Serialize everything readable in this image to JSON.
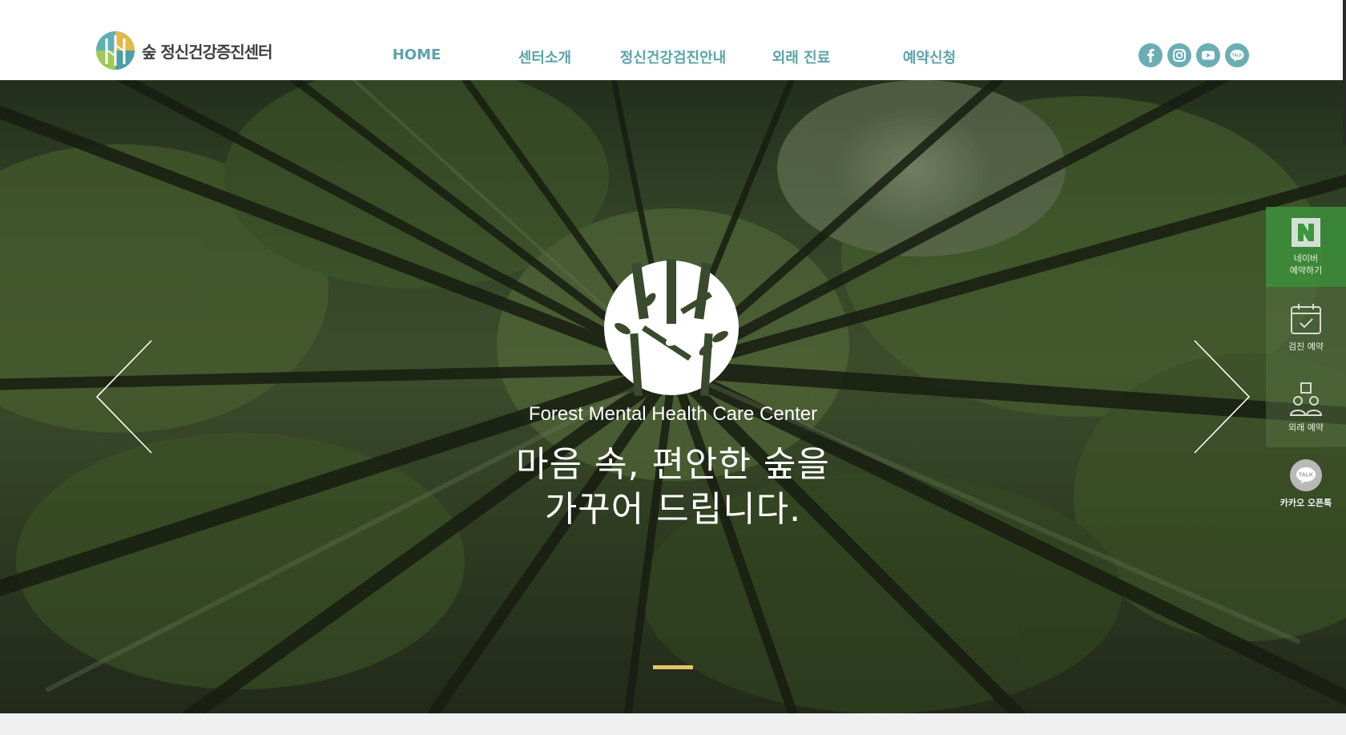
{
  "header": {
    "logo_text": "숲 정신건강증진센터",
    "nav": [
      {
        "label": "HOME"
      },
      {
        "label": "센터소개"
      },
      {
        "label": "정신건강검진안내"
      },
      {
        "label": "외래 진료"
      },
      {
        "label": "예약신청"
      }
    ],
    "social": [
      {
        "icon": "facebook-icon"
      },
      {
        "icon": "instagram-icon"
      },
      {
        "icon": "youtube-icon"
      },
      {
        "icon": "kakaotalk-icon",
        "label": "TALK"
      }
    ]
  },
  "hero": {
    "subtitle": "Forest Mental Health Care Center",
    "title_line1": "마음 속, 편안한 숲을",
    "title_line2": "가꾸어 드립니다.",
    "active_slide": 1
  },
  "quick_menu": {
    "naver": {
      "icon": "naver-n-icon",
      "line1": "네이버",
      "line2": "예약하기"
    },
    "checkup": {
      "icon": "calendar-check-icon",
      "label": "검진 예약"
    },
    "outpatient": {
      "icon": "people-icon",
      "label": "외래 예약"
    },
    "kakao": {
      "icon": "kakaotalk-icon",
      "badge": "TALK",
      "label": "카카오 오픈톡"
    }
  },
  "colors": {
    "nav_text": "#5ba3a8",
    "social_bg": "#6aaeb4",
    "slide_indicator": "#e6c36a",
    "naver_green": "#3c963c"
  }
}
